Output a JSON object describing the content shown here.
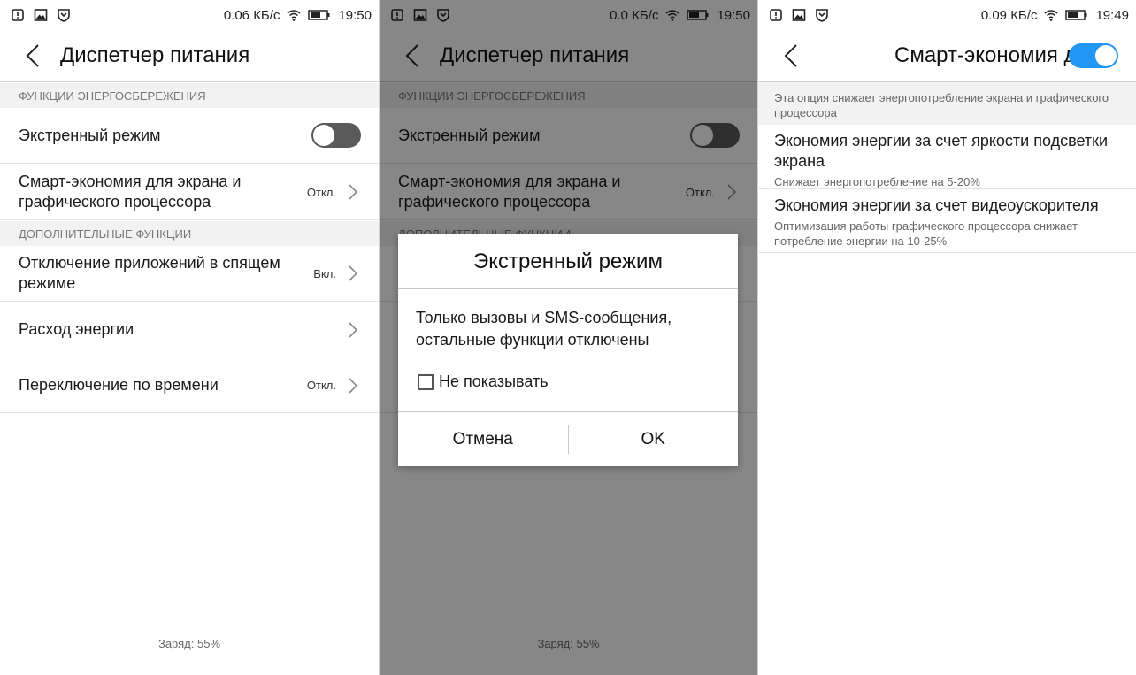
{
  "screens": [
    {
      "status": {
        "speed": "0.06 КБ/с",
        "time": "19:50"
      },
      "title": "Диспетчер питания",
      "sections": [
        {
          "header": "ФУНКЦИИ ЭНЕРГОСБЕРЕЖЕНИЯ"
        },
        {
          "header": "ДОПОЛНИТЕЛЬНЫЕ ФУНКЦИИ"
        }
      ],
      "rows": [
        {
          "label": "Экстренный режим",
          "toggle": false
        },
        {
          "label": "Смарт-экономия для экрана и графического процессора",
          "value": "Откл."
        },
        {
          "label": "Отключение приложений в спящем режиме",
          "value": "Вкл."
        },
        {
          "label": "Расход энергии",
          "value": ""
        },
        {
          "label": "Переключение по времени",
          "value": "Откл."
        }
      ],
      "footer": "Заряд: 55%"
    },
    {
      "status": {
        "speed": "0.0 КБ/с",
        "time": "19:50"
      },
      "title": "Диспетчер питания",
      "sections": [
        {
          "header": "ФУНКЦИИ ЭНЕРГОСБЕРЕЖЕНИЯ"
        },
        {
          "header": "ДОПОЛНИТЕЛЬНЫЕ ФУНКЦИИ"
        }
      ],
      "rows": [
        {
          "label": "Экстренный режим",
          "toggle": false
        },
        {
          "label": "Смарт-экономия для экрана и графического процессора",
          "value": "Откл."
        }
      ],
      "dialog": {
        "title": "Экстренный режим",
        "message": "Только вызовы и SMS-сообщения, остальные функции отключены",
        "checkbox_label": "Не показывать",
        "cancel": "Отмена",
        "ok": "OK"
      },
      "footer": "Заряд: 55%"
    },
    {
      "status": {
        "speed": "0.09 КБ/с",
        "time": "19:49"
      },
      "title": "Смарт-экономия для экрана и графического процессора",
      "toggle": true,
      "description": "Эта опция снижает энергопотребление экрана и графического процессора",
      "options": [
        {
          "title": "Экономия энергии за счет яркости подсветки экрана",
          "subtitle": "Снижает энергопотребление на 5-20%"
        },
        {
          "title": "Экономия энергии за счет видеоускорителя",
          "subtitle": "Оптимизация работы графического процессора снижает потребление энергии на 10-25%"
        }
      ]
    }
  ],
  "colors": {
    "accent": "#2196f3",
    "toggle_off": "#5a5a5a",
    "section_bg": "#f2f2f2"
  },
  "icons": [
    "notification-icon",
    "gallery-icon",
    "shield-icon",
    "wifi-icon",
    "battery-icon",
    "back-chevron-icon",
    "chevron-right-icon"
  ]
}
